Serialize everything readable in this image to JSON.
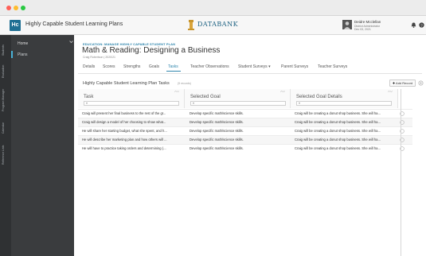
{
  "window": {
    "dots": [
      "#ff5f57",
      "#febc2e",
      "#28c840"
    ]
  },
  "app": {
    "logo": "Hc",
    "title": "Highly Capable Student Learning Plans"
  },
  "brand": {
    "name": "DATABANK"
  },
  "user": {
    "name": "Deidre Mcclellan",
    "role": "District Administrator",
    "date": "Dec 03, 2021"
  },
  "rail": {
    "items": [
      "Students",
      "Evaluation",
      "Program Manager",
      "Calendar",
      "Reference Lists"
    ]
  },
  "sidebar": {
    "home": "Home",
    "plans": "Plans"
  },
  "breadcrumb": "EDUCATION: MANAGE HIGHLY CAPABLE STUDENT PLAN",
  "plan": {
    "title": "Math & Reading: Designing a Business",
    "subtitle": "Craig Robertson | 2020/21"
  },
  "tabs": [
    {
      "label": "Details"
    },
    {
      "label": "Scores"
    },
    {
      "label": "Strengths"
    },
    {
      "label": "Goals"
    },
    {
      "label": "Tasks",
      "active": true
    },
    {
      "label": "Teacher Observations"
    },
    {
      "label": "Student Surveys ▾"
    },
    {
      "label": "Parent Surveys"
    },
    {
      "label": "Teacher Surveys"
    }
  ],
  "section": {
    "title": "Highly Capable Student Learning Plan Tasks",
    "count": "(5 records)",
    "add_label": "✚ Add Record"
  },
  "table": {
    "columns": [
      "Task",
      "Selected Goal",
      "Selected Goal Details"
    ],
    "filter_placeholder": "▾",
    "rows": [
      [
        "Craig will present her final business to the rest of the gr...",
        "Develop specific math/science skills.",
        "Craig will be creating a donut shop business. She will ha..."
      ],
      [
        "Craig will design a model of her choosing to show what...",
        "Develop specific math/science skills.",
        "Craig will be creating a donut shop business. She will ha..."
      ],
      [
        "He will share her starting budget, what she spent, and h...",
        "Develop specific math/science skills.",
        "Craig will be creating a donut shop business. She will ha..."
      ],
      [
        "He will describe her marketing plan and how others will ...",
        "Develop specific math/science skills.",
        "Craig will be creating a donut shop business. She will ha..."
      ],
      [
        "He will have to practice taking orders and determining (...",
        "Develop specific math/science skills.",
        "Craig will be creating a donut shop business. She will ha..."
      ]
    ]
  },
  "colors": {
    "accent": "#2f86ad",
    "rail_bg": "#2f3133",
    "sidebar_bg": "#3a3c3e"
  }
}
